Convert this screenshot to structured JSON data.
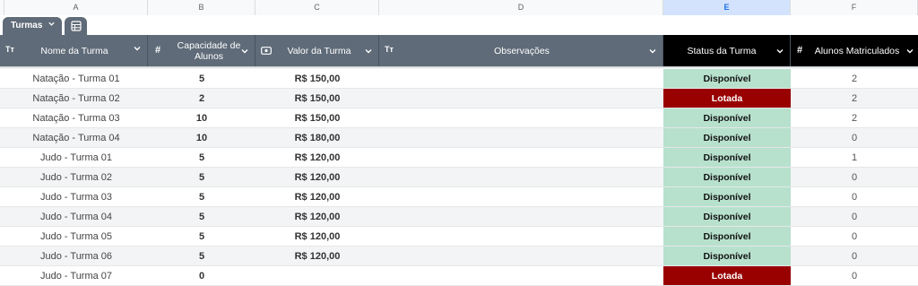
{
  "columns": [
    "A",
    "B",
    "C",
    "D",
    "E",
    "F"
  ],
  "table_name": "Turmas",
  "icons": {
    "dropdown": "chevron-down-icon",
    "table_view": "table-view-icon",
    "text_type": "text-type-icon",
    "number_type": "number-type-icon",
    "currency_type": "currency-type-icon"
  },
  "headers": {
    "nome": "Nome da Turma",
    "capacidade": "Capacidade de Alunos",
    "valor": "Valor da Turma",
    "observacoes": "Observações",
    "status": "Status da Turma",
    "matriculados": "Alunos Matriculados",
    "text_type_glyph": "Tт",
    "number_type_glyph": "#"
  },
  "colors": {
    "header_bg": "#5f6b78",
    "status_header_bg": "#000000",
    "disponivel": "#b7e1cd",
    "lotada": "#990000",
    "selected_column": "#d3e3fd"
  },
  "rows": [
    {
      "nome": "Natação - Turma 01",
      "capacidade": "5",
      "valor": "R$ 150,00",
      "observacoes": "",
      "status": "Disponível",
      "matriculados": "2"
    },
    {
      "nome": "Natação - Turma 02",
      "capacidade": "2",
      "valor": "R$ 150,00",
      "observacoes": "",
      "status": "Lotada",
      "matriculados": "2"
    },
    {
      "nome": "Natação - Turma 03",
      "capacidade": "10",
      "valor": "R$ 150,00",
      "observacoes": "",
      "status": "Disponível",
      "matriculados": "2"
    },
    {
      "nome": "Natação - Turma 04",
      "capacidade": "10",
      "valor": "R$ 180,00",
      "observacoes": "",
      "status": "Disponível",
      "matriculados": "0"
    },
    {
      "nome": "Judo - Turma 01",
      "capacidade": "5",
      "valor": "R$ 120,00",
      "observacoes": "",
      "status": "Disponível",
      "matriculados": "1"
    },
    {
      "nome": "Judo - Turma 02",
      "capacidade": "5",
      "valor": "R$ 120,00",
      "observacoes": "",
      "status": "Disponível",
      "matriculados": "0"
    },
    {
      "nome": "Judo - Turma 03",
      "capacidade": "5",
      "valor": "R$ 120,00",
      "observacoes": "",
      "status": "Disponível",
      "matriculados": "0"
    },
    {
      "nome": "Judo - Turma 04",
      "capacidade": "5",
      "valor": "R$ 120,00",
      "observacoes": "",
      "status": "Disponível",
      "matriculados": "0"
    },
    {
      "nome": "Judo - Turma 05",
      "capacidade": "5",
      "valor": "R$ 120,00",
      "observacoes": "",
      "status": "Disponível",
      "matriculados": "0"
    },
    {
      "nome": "Judo - Turma 06",
      "capacidade": "5",
      "valor": "R$ 120,00",
      "observacoes": "",
      "status": "Disponível",
      "matriculados": "0"
    },
    {
      "nome": "Judo - Turma 07",
      "capacidade": "0",
      "valor": "",
      "observacoes": "",
      "status": "Lotada",
      "matriculados": "0"
    }
  ]
}
